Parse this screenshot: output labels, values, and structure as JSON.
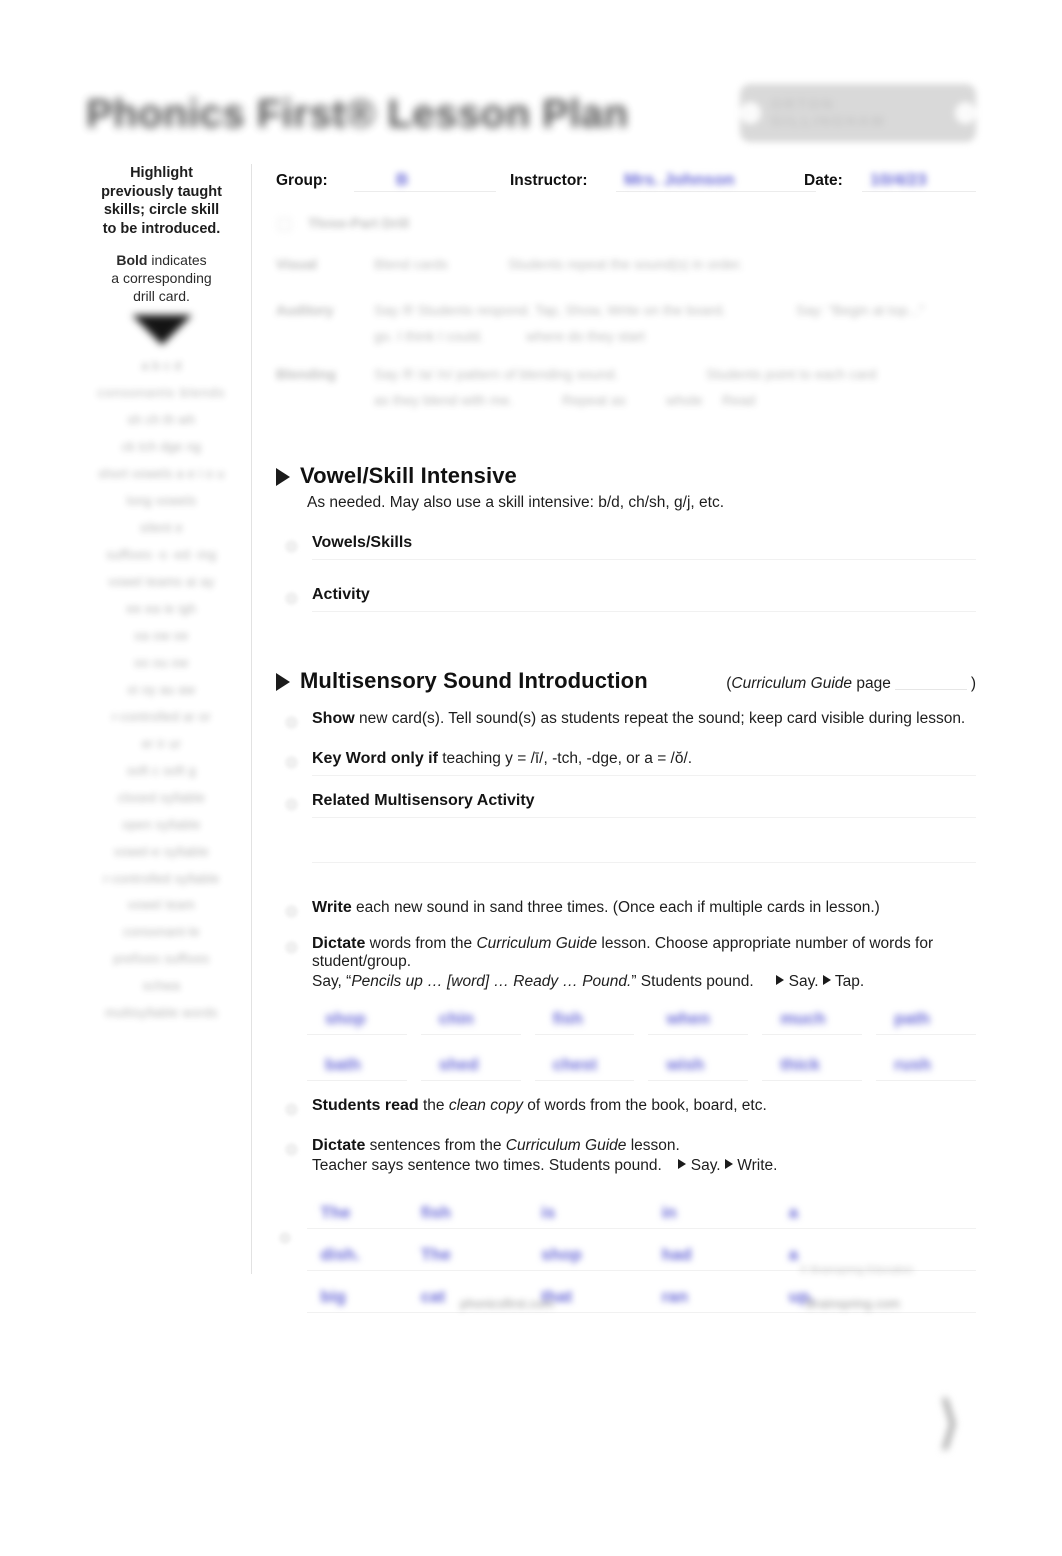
{
  "document": {
    "title": "Phonics First® Lesson Plan",
    "brand_badge": {
      "text": "ORTON  GILLINGHAM",
      "icon_left": "dot-icon",
      "icon_right": "dot-icon"
    }
  },
  "sidebar": {
    "note_bold": "Highlight previously taught skills; circle skill to be introduced.",
    "note_bold_lines": [
      "Highlight",
      "previously taught",
      "skills; circle skill",
      "to be introduced."
    ],
    "note_secondary_bold": "Bold",
    "note_secondary_rest": " indicates",
    "note_secondary_lines": [
      "a corresponding",
      "drill card."
    ],
    "skill_items": [
      "a  b  c  d",
      "consonants  blends",
      "sh  ch  th  wh",
      "ck  tch  dge  ng",
      "short vowels  a e i o u",
      "long vowels",
      "silent e",
      "suffixes  -s -ed -ing",
      "vowel teams  ai ay",
      "ee ea  ie igh",
      "oa ow  oe",
      "oo  ou ow",
      "oi oy  au aw",
      "r-controlled  ar or",
      "er ir ur",
      "soft c  soft g",
      "closed syllable",
      "open syllable",
      "vowel-e syllable",
      "r-controlled syllable",
      "vowel team",
      "consonant-le",
      "prefixes  suffixes",
      "schwa",
      "multisyllable words"
    ]
  },
  "meta": {
    "group_label": "Group:",
    "group_value": "B",
    "instructor_label": "Instructor:",
    "instructor_value": "Mrs. Johnson",
    "date_label": "Date:",
    "date_value": "10/4/23"
  },
  "intro_block": {
    "checkbox_line": "Three-Part Drill",
    "rows": [
      {
        "label": "Visual",
        "col1": "Blend cards",
        "col2": "Students repeat the sound(s) in order."
      },
      {
        "label": "Auditory",
        "col1": "Say /f/ Students respond. Tap, Show, Write on the board.",
        "col2": "Say: \"Begin at top...\"",
        "col1b": "go. I think I could.",
        "col2b": "where do they start"
      },
      {
        "label": "Blending",
        "col1": "Say /f/ /a/ /n/ pattern of blending sound.",
        "col2": "Students point to each card",
        "col1b": "as they blend with me.",
        "col2b": "Repeat as",
        "col3b": "whole",
        "col4b": "Read"
      }
    ]
  },
  "sections": [
    {
      "id": "vowel-skill-intensive",
      "title": "Vowel/Skill Intensive",
      "subtitle": "As needed. May also use a skill intensive: b/d, ch/sh, g/j, etc.",
      "rows": [
        {
          "label": "Vowels/Skills",
          "text": ""
        },
        {
          "label": "Activity",
          "text": ""
        }
      ]
    },
    {
      "id": "multisensory-sound-introduction",
      "title": "Multisensory Sound Introduction",
      "note_prefix": "(",
      "note_italic": "Curriculum Guide",
      "note_suffix": " page",
      "note_close": ")",
      "rows": [
        {
          "label": "Show",
          "text": " new card(s). Tell sound(s) as students repeat the sound; keep card visible during lesson."
        },
        {
          "label": "Key Word only if",
          "text": " teaching y = /ī/, -tch, -dge, or a = /ŏ/."
        },
        {
          "label": "Related Multisensory Activity",
          "text": ""
        },
        {
          "label": "Write",
          "text": " each new sound in sand three times. (Once each if multiple cards in lesson.)"
        },
        {
          "label": "Dictate",
          "text": " words from the ",
          "text_italic": "Curriculum Guide",
          "text_after": " lesson. Choose appropriate number of words for student/group.",
          "say_prefix": "Say, “",
          "say_italic": "Pencils up … [word] … Ready … Pound.",
          "say_after": "” Students pound.",
          "cue_1": "Say.",
          "cue_2": "Tap."
        },
        {
          "label": "Students read",
          "text": " the ",
          "text_italic": "clean copy",
          "text_after": " of words from the book, board, etc."
        },
        {
          "label": "Dictate",
          "text": " sentences from the ",
          "text_italic": "Curriculum Guide",
          "text_after": " lesson.",
          "line2": "Teacher says sentence two times. Students pound.",
          "cue_1": "Say.",
          "cue_2": "Write."
        }
      ]
    }
  ],
  "dictation_words": {
    "row1": [
      "shop",
      "chin",
      "fish",
      "when",
      "much",
      "path"
    ],
    "row2": [
      "bath",
      "shed",
      "chest",
      "wish",
      "thick",
      "rush"
    ]
  },
  "dictation_sentences": [
    [
      "The",
      "fish",
      "is",
      "in",
      "a"
    ],
    [
      "dish.",
      "The",
      "shop",
      "had",
      "a"
    ],
    [
      "big",
      "cat",
      "that",
      "ran",
      "up."
    ]
  ],
  "scribble_mark": "⟩",
  "footer": {
    "left": "phonicsfirst.com",
    "right_small": "© Brainspring Education",
    "right": "Brainspring.com"
  },
  "colors": {
    "handwriting": "#6b6bd8",
    "text": "#1d1d1d",
    "rule": "#f1f1f1",
    "badge_bg": "#d9d9d9"
  }
}
